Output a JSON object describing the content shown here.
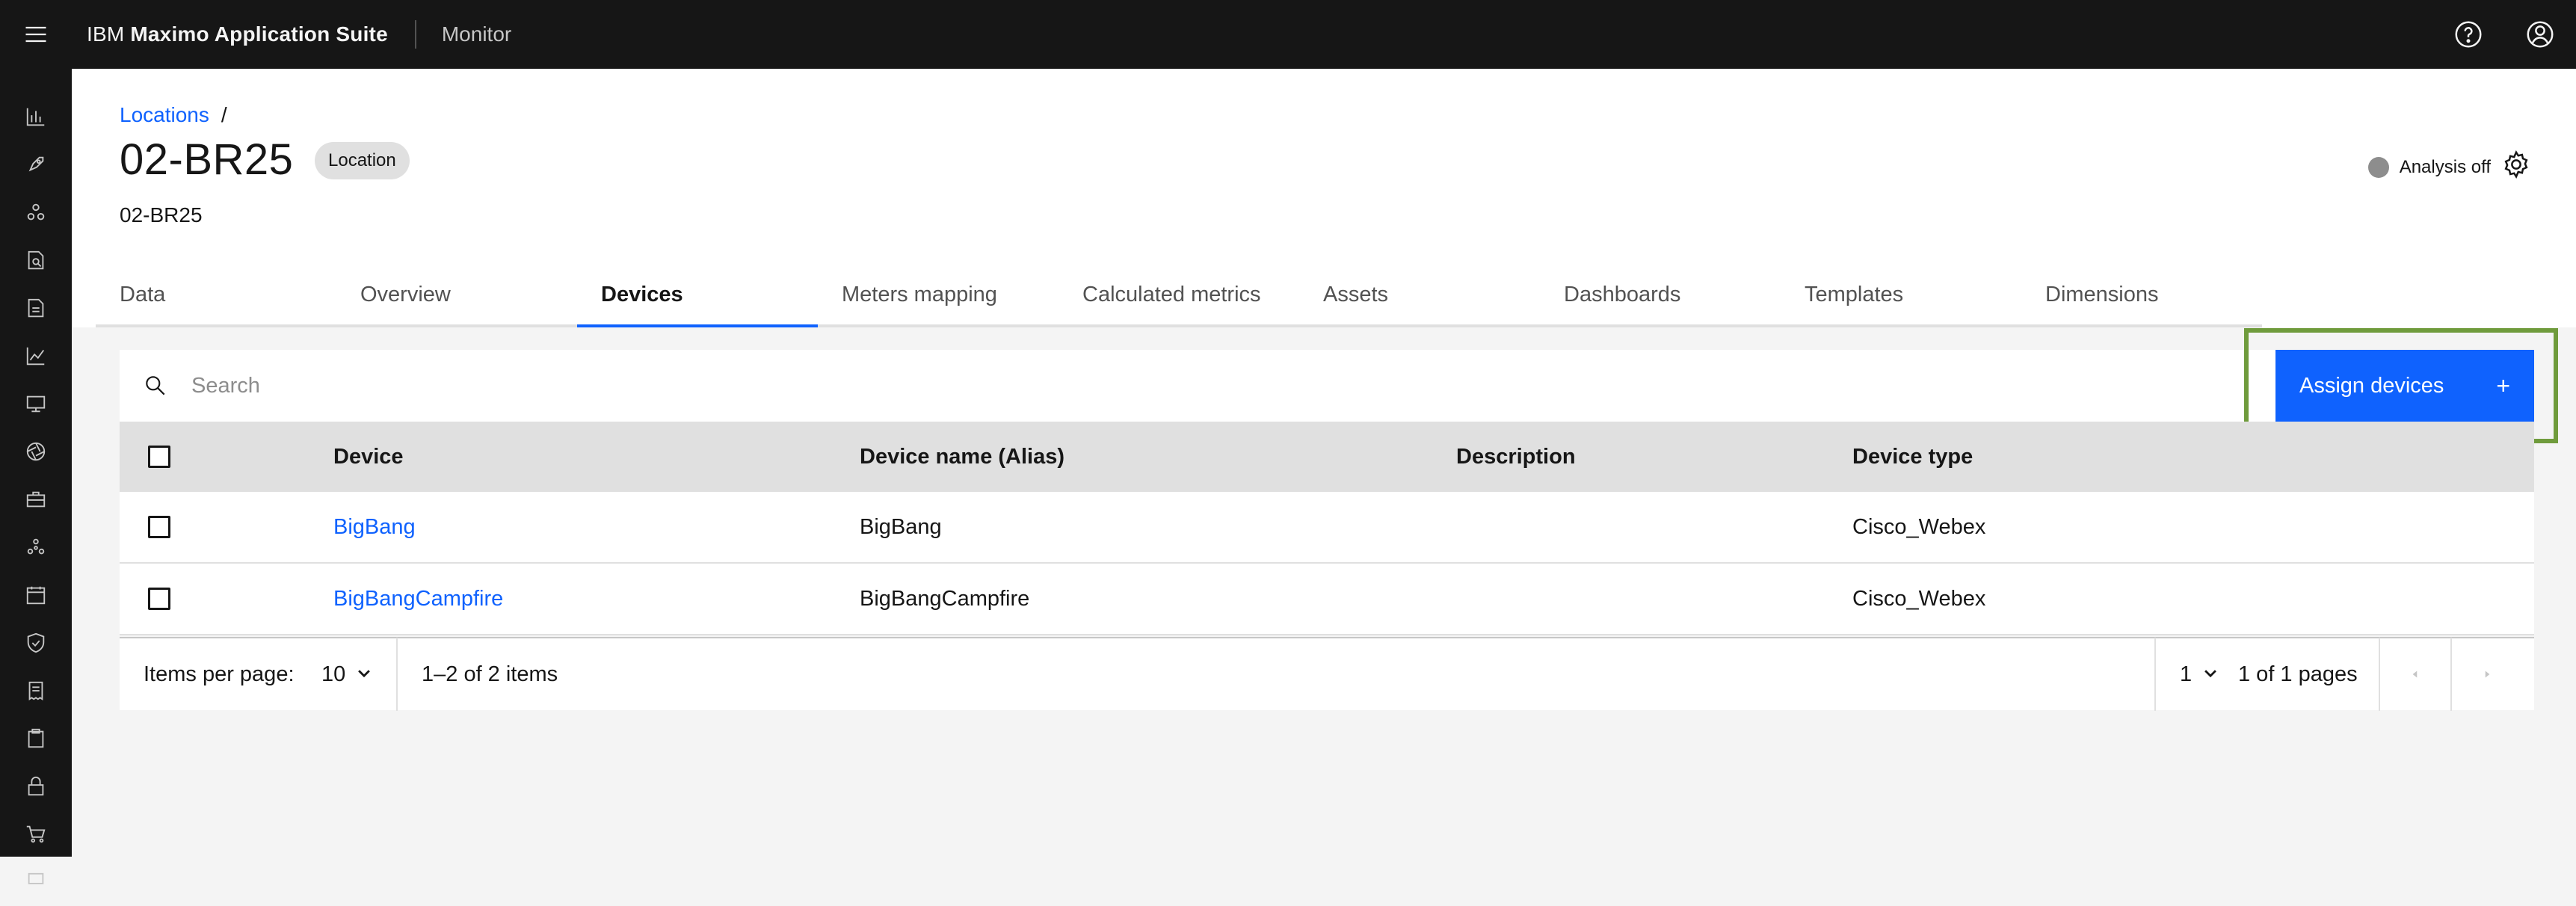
{
  "header": {
    "brand_prefix": "IBM",
    "brand_name": "Maximo Application Suite",
    "product": "Monitor"
  },
  "breadcrumb": {
    "link": "Locations",
    "separator": "/"
  },
  "page": {
    "title": "02-BR25",
    "tag": "Location",
    "subtitle": "02-BR25",
    "analysis_status": "Analysis off"
  },
  "tabs": [
    {
      "label": "Data"
    },
    {
      "label": "Overview"
    },
    {
      "label": "Devices",
      "selected": true
    },
    {
      "label": "Meters mapping"
    },
    {
      "label": "Calculated metrics"
    },
    {
      "label": "Assets"
    },
    {
      "label": "Dashboards"
    },
    {
      "label": "Templates"
    },
    {
      "label": "Dimensions"
    }
  ],
  "toolbar": {
    "search_placeholder": "Search",
    "assign_label": "Assign devices",
    "assign_icon": "+"
  },
  "table": {
    "columns": [
      "Device",
      "Device name (Alias)",
      "Description",
      "Device type"
    ],
    "rows": [
      {
        "device": "BigBang",
        "alias": "BigBang",
        "description": "",
        "type": "Cisco_Webex"
      },
      {
        "device": "BigBangCampfire",
        "alias": "BigBangCampfire",
        "description": "",
        "type": "Cisco_Webex"
      }
    ]
  },
  "pagination": {
    "items_per_page_label": "Items per page:",
    "items_per_page": "10",
    "range": "1–2 of 2 items",
    "page": "1",
    "page_of": "1 of 1 pages"
  },
  "colors": {
    "accent": "#0f62fe",
    "highlight": "#6f9b3c",
    "header_bg": "#161616"
  }
}
